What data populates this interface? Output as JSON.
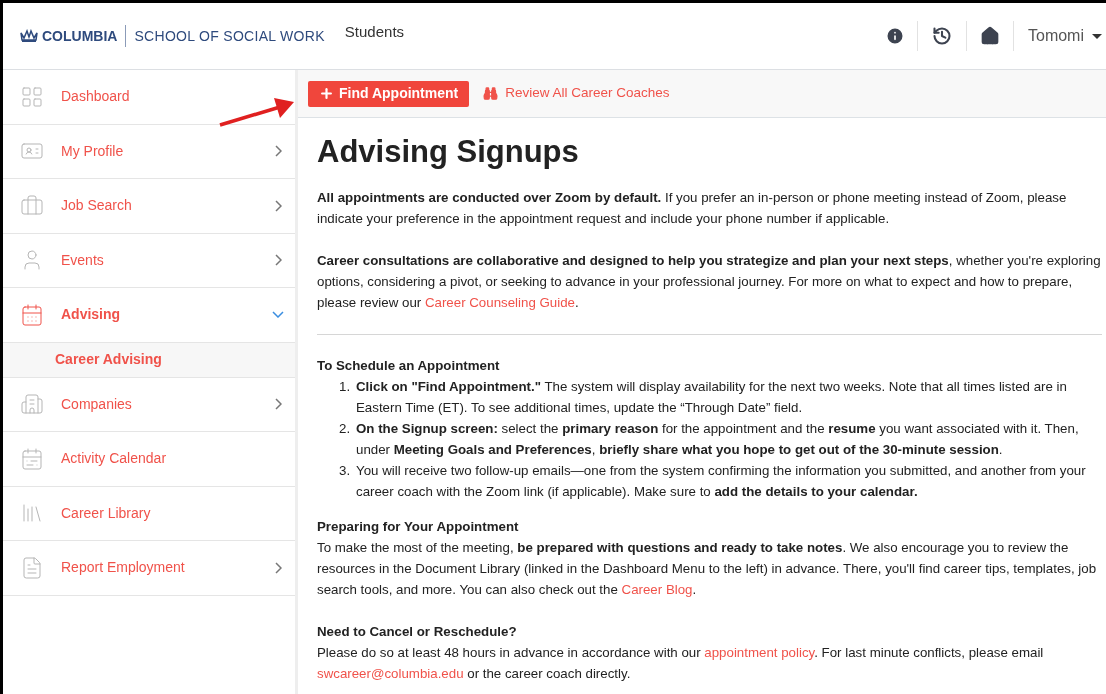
{
  "header": {
    "brand": "COLUMBIA",
    "school": "SCHOOL OF SOCIAL WORK",
    "section": "Students",
    "user": "Tomomi"
  },
  "sidebar": {
    "items": [
      {
        "label": "Dashboard",
        "selected": false,
        "has_submenu": false,
        "expanded": false
      },
      {
        "label": "My Profile",
        "selected": false,
        "has_submenu": true,
        "expanded": false
      },
      {
        "label": "Job Search",
        "selected": false,
        "has_submenu": true,
        "expanded": false
      },
      {
        "label": "Events",
        "selected": false,
        "has_submenu": true,
        "expanded": false
      },
      {
        "label": "Advising",
        "selected": true,
        "has_submenu": true,
        "expanded": true,
        "children": [
          {
            "label": "Career Advising",
            "selected": true
          }
        ]
      },
      {
        "label": "Companies",
        "selected": false,
        "has_submenu": true,
        "expanded": false
      },
      {
        "label": "Activity Calendar",
        "selected": false,
        "has_submenu": false,
        "expanded": false
      },
      {
        "label": "Career Library",
        "selected": false,
        "has_submenu": false,
        "expanded": false
      },
      {
        "label": "Report Employment",
        "selected": false,
        "has_submenu": true,
        "expanded": false
      }
    ]
  },
  "toolbar": {
    "primary_button": "Find Appointment",
    "link": "Review All Career Coaches"
  },
  "content": {
    "title": "Advising Signups",
    "blocks": [
      {
        "kind": "paragraph",
        "segments": [
          {
            "kind": "bold",
            "text": "All appointments are conducted over Zoom by default."
          },
          {
            "kind": "text",
            "text": " If you prefer an in-person or phone meeting instead of Zoom, please indicate your preference in the appointment request and include your phone number if applicable."
          }
        ]
      },
      {
        "kind": "paragraph",
        "segments": [
          {
            "kind": "bold",
            "text": "Career consultations are collaborative and designed to help you strategize and plan your next steps"
          },
          {
            "kind": "text",
            "text": ", whether you're exploring options, considering a pivot, or seeking to advance in your professional journey. For more on what to expect and how to prepare, please review our "
          },
          {
            "kind": "link",
            "text": "Career Counseling Guide"
          },
          {
            "kind": "text",
            "text": "."
          }
        ]
      },
      {
        "kind": "divider"
      },
      {
        "kind": "list",
        "heading": "To Schedule an Appointment",
        "items": [
          {
            "number": "1.",
            "segments": [
              {
                "kind": "bold",
                "text": "Click on \"Find Appointment.\""
              },
              {
                "kind": "text",
                "text": " The system will display availability for the next two weeks. Note that all times listed are in Eastern Time (ET). To see additional times, update the “Through Date” field."
              }
            ]
          },
          {
            "number": "2.",
            "segments": [
              {
                "kind": "bold",
                "text": "On the Signup screen:"
              },
              {
                "kind": "text",
                "text": " select the "
              },
              {
                "kind": "bold",
                "text": "primary reason"
              },
              {
                "kind": "text",
                "text": " for the appointment and the "
              },
              {
                "kind": "bold",
                "text": "resume"
              },
              {
                "kind": "text",
                "text": " you want associated with it. Then, under "
              },
              {
                "kind": "bold",
                "text": "Meeting Goals and Preferences"
              },
              {
                "kind": "text",
                "text": ", "
              },
              {
                "kind": "bold",
                "text": "briefly share what you hope to get out of the 30-minute session"
              },
              {
                "kind": "text",
                "text": "."
              }
            ]
          },
          {
            "number": "3.",
            "segments": [
              {
                "kind": "text",
                "text": "You will receive two follow-up emails—one from the system confirming the information you submitted, and another from your career coach with the Zoom link (if applicable). Make sure to "
              },
              {
                "kind": "bold",
                "text": "add the details to your calendar."
              }
            ]
          }
        ]
      },
      {
        "kind": "section",
        "heading": "Preparing for Your Appointment",
        "segments": [
          {
            "kind": "text",
            "text": "To make the most of the meeting, "
          },
          {
            "kind": "bold",
            "text": "be prepared with questions and ready to take notes"
          },
          {
            "kind": "text",
            "text": ". We also encourage you to review the resources in the Document Library (linked in the Dashboard Menu to the left) in advance. There, you'll find career tips, templates, job search tools, and more. You can also check out the "
          },
          {
            "kind": "link",
            "text": "Career Blog"
          },
          {
            "kind": "text",
            "text": "."
          }
        ]
      },
      {
        "kind": "section",
        "heading": "Need to Cancel or Reschedule?",
        "segments": [
          {
            "kind": "text",
            "text": "Please do so at least 48 hours in advance in accordance with our "
          },
          {
            "kind": "link",
            "text": "appointment policy"
          },
          {
            "kind": "text",
            "text": ". For last minute conflicts, please email "
          },
          {
            "kind": "link",
            "text": "swcareer@columbia.edu"
          },
          {
            "kind": "text",
            "text": " or the career coach directly."
          }
        ]
      }
    ]
  }
}
